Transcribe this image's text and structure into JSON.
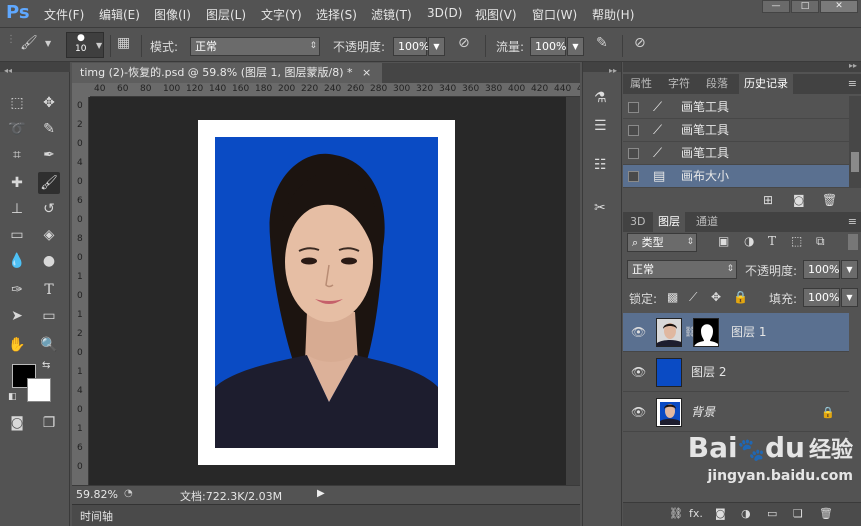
{
  "app": {
    "logo": "Ps"
  },
  "menu": [
    "文件(F)",
    "编辑(E)",
    "图像(I)",
    "图层(L)",
    "文字(Y)",
    "选择(S)",
    "滤镜(T)",
    "3D(D)",
    "视图(V)",
    "窗口(W)",
    "帮助(H)"
  ],
  "window_controls": {
    "minimize": "—",
    "maximize": "□",
    "close": "✕"
  },
  "options": {
    "brush_size": "10",
    "mode_label": "模式:",
    "mode_value": "正常",
    "opacity_label": "不透明度:",
    "opacity_value": "100%",
    "flow_label": "流量:",
    "flow_value": "100%"
  },
  "document": {
    "tab_title": "timg (2)-恢复的.psd @ 59.8% (图层 1, 图层蒙版/8) *",
    "tab_close": "×",
    "ruler_top": [
      "40",
      "60",
      "80",
      "100",
      "120",
      "140",
      "160",
      "180",
      "200",
      "220",
      "240",
      "260",
      "280",
      "300",
      "320",
      "340",
      "360",
      "380",
      "400",
      "420",
      "440",
      "460",
      "480",
      "500",
      "520"
    ],
    "ruler_left": [
      "0",
      "2",
      "0",
      "4",
      "0",
      "6",
      "0",
      "8",
      "0",
      "1",
      "0",
      "1",
      "2",
      "0",
      "1",
      "4",
      "0",
      "1",
      "6",
      "0"
    ],
    "zoom": "59.82%",
    "doc_info": "文档:722.3K/2.03M",
    "timeline_label": "时间轴"
  },
  "history_panel": {
    "tabs": [
      "属性",
      "字符",
      "段落",
      "历史记录"
    ],
    "active_tab": "历史记录",
    "items": [
      {
        "label": "画笔工具",
        "selected": false
      },
      {
        "label": "画笔工具",
        "selected": false
      },
      {
        "label": "画笔工具",
        "selected": false
      },
      {
        "label": "画布大小",
        "selected": true
      }
    ]
  },
  "layers_panel": {
    "tabs": [
      "3D",
      "图层",
      "通道"
    ],
    "active_tab": "图层",
    "filter_label": "类型",
    "blend_mode": "正常",
    "opacity_label": "不透明度:",
    "opacity_value": "100%",
    "lock_label": "锁定:",
    "fill_label": "填充:",
    "fill_value": "100%",
    "layers": [
      {
        "name": "图层 1",
        "selected": true,
        "has_mask": true
      },
      {
        "name": "图层 2",
        "selected": false,
        "has_mask": false
      },
      {
        "name": "背景",
        "selected": false,
        "locked": true
      }
    ],
    "bottom_icons": [
      "link-icon",
      "fx-icon",
      "mask-icon",
      "adjustment-icon",
      "folder-icon",
      "new-layer-icon",
      "trash-icon"
    ],
    "fx_label": "fx."
  },
  "watermark": {
    "line1": "Bai",
    "paw": "🐾",
    "line1b": "du",
    "line1c": "经验",
    "line2": "jingyan.baidu.com"
  },
  "colors": {
    "accent": "#5a7090",
    "canvas_bg": "#0a4bc4",
    "ui_bg": "#535353"
  }
}
